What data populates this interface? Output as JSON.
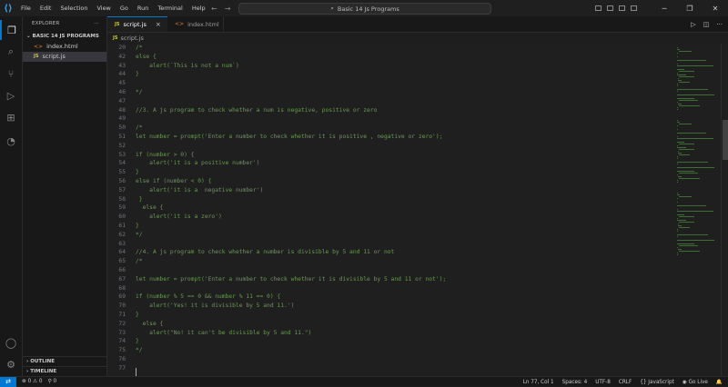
{
  "window": {
    "menu": [
      "File",
      "Edit",
      "Selection",
      "View",
      "Go",
      "Run",
      "Terminal",
      "Help"
    ],
    "search_text": "Basic 14 Js Programs"
  },
  "sidebar": {
    "header": "EXPLORER",
    "folder": "BASIC 14 JS PROGRAMS",
    "files": [
      {
        "name": "index.html",
        "type": "html"
      },
      {
        "name": "script.js",
        "type": "js"
      }
    ],
    "outline_label": "OUTLINE",
    "timeline_label": "TIMELINE"
  },
  "tabs": [
    {
      "label": "script.js",
      "type": "js"
    },
    {
      "label": "index.html",
      "type": "html"
    }
  ],
  "breadcrumb": "script.js",
  "editor": {
    "lines": [
      {
        "n": "20",
        "text": "/*"
      },
      {
        "n": "42",
        "text": "else {"
      },
      {
        "n": "43",
        "text": "    alert(`This is not a num`)"
      },
      {
        "n": "44",
        "text": "}"
      },
      {
        "n": "45",
        "text": ""
      },
      {
        "n": "46",
        "text": "*/"
      },
      {
        "n": "47",
        "text": ""
      },
      {
        "n": "48",
        "text": "//3. A js program to check whether a num is negative, positive or zero"
      },
      {
        "n": "49",
        "text": ""
      },
      {
        "n": "50",
        "text": "/*"
      },
      {
        "n": "51",
        "text": "let number = prompt('Enter a number to check whether it is positive , negative or zero');"
      },
      {
        "n": "52",
        "text": ""
      },
      {
        "n": "53",
        "text": "if (number > 0) {"
      },
      {
        "n": "54",
        "text": "    alert('it is a positive number')"
      },
      {
        "n": "55",
        "text": "}"
      },
      {
        "n": "56",
        "text": "else if (number < 0) {"
      },
      {
        "n": "57",
        "text": "    alert('it is a  negative number')"
      },
      {
        "n": "58",
        "text": " }"
      },
      {
        "n": "59",
        "text": "  else {"
      },
      {
        "n": "60",
        "text": "    alert('it is a zero')"
      },
      {
        "n": "61",
        "text": "}"
      },
      {
        "n": "62",
        "text": "*/"
      },
      {
        "n": "63",
        "text": ""
      },
      {
        "n": "64",
        "text": "//4. A js program to check whether a number is divisible by 5 and 11 or not"
      },
      {
        "n": "65",
        "text": "/*"
      },
      {
        "n": "66",
        "text": ""
      },
      {
        "n": "67",
        "text": "let number = prompt('Enter a number to check whether it is divisible by 5 and 11 or not');"
      },
      {
        "n": "68",
        "text": ""
      },
      {
        "n": "69",
        "text": "if (number % 5 == 0 && number % 11 == 0) {"
      },
      {
        "n": "70",
        "text": "    alert('Yes! it is divisible by 5 and 11.')"
      },
      {
        "n": "71",
        "text": "}"
      },
      {
        "n": "72",
        "text": "  else {"
      },
      {
        "n": "73",
        "text": "    alert(\"No! it can't be divisible by 5 and 11.\")"
      },
      {
        "n": "74",
        "text": "}"
      },
      {
        "n": "75",
        "text": "*/"
      },
      {
        "n": "76",
        "text": ""
      },
      {
        "n": "77",
        "text": ""
      }
    ]
  },
  "statusbar": {
    "errors": "0",
    "warnings": "0",
    "ports": "0",
    "position": "Ln 77, Col 1",
    "spaces": "Spaces: 4",
    "encoding": "UTF-8",
    "eol": "CRLF",
    "language": "JavaScript",
    "golive": "Go Live"
  },
  "colors": {
    "accent": "#0078d4",
    "comment": "#6a9955",
    "background": "#1f1f1f"
  }
}
